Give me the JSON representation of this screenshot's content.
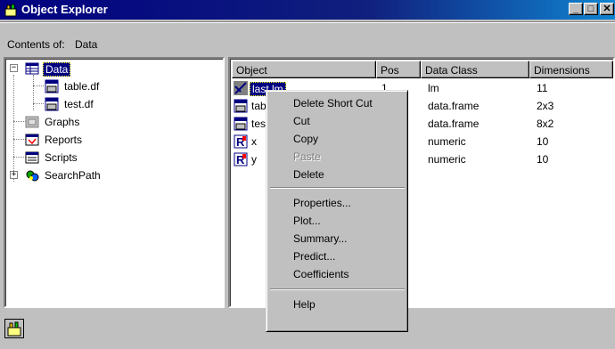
{
  "window": {
    "title": "Object Explorer",
    "icon": "object-explorer-icon",
    "minimize": "_",
    "maximize": "□",
    "close": "✕"
  },
  "contents": {
    "label": "Contents of:",
    "value": "Data"
  },
  "tree": {
    "items": [
      {
        "label": "Data",
        "icon": "data-folder-icon",
        "selected": true,
        "expanded": true
      },
      {
        "label": "table.df",
        "icon": "data-frame-icon"
      },
      {
        "label": "test.df",
        "icon": "data-frame-icon"
      },
      {
        "label": "Graphs",
        "icon": "graphs-icon"
      },
      {
        "label": "Reports",
        "icon": "reports-icon"
      },
      {
        "label": "Scripts",
        "icon": "scripts-icon"
      },
      {
        "label": "SearchPath",
        "icon": "searchpath-icon",
        "expanded": false
      }
    ],
    "expand_minus": "−",
    "expand_plus": "+"
  },
  "list": {
    "columns": [
      "Object",
      "Pos",
      "Data Class",
      "Dimensions"
    ],
    "rows": [
      {
        "object": "last.lm",
        "pos": "1",
        "class": "lm",
        "dims": "11",
        "icon": "model-icon",
        "selected": true
      },
      {
        "object": "tab",
        "pos": "",
        "class": "data.frame",
        "dims": "2x3",
        "icon": "data-frame-icon"
      },
      {
        "object": "tes",
        "pos": "",
        "class": "data.frame",
        "dims": "8x2",
        "icon": "data-frame-icon"
      },
      {
        "object": "x",
        "pos": "",
        "class": "numeric",
        "dims": "10",
        "icon": "vector-icon"
      },
      {
        "object": "y",
        "pos": "",
        "class": "numeric",
        "dims": "10",
        "icon": "vector-icon"
      }
    ]
  },
  "context_menu": {
    "items": [
      {
        "label": "Delete Short Cut",
        "disabled": false
      },
      {
        "label": "Cut",
        "disabled": false
      },
      {
        "label": "Copy",
        "disabled": false
      },
      {
        "label": "Paste",
        "disabled": true
      },
      {
        "label": "Delete",
        "disabled": false
      },
      {
        "label": "Properties...",
        "disabled": false
      },
      {
        "label": "Plot...",
        "disabled": false
      },
      {
        "label": "Summary...",
        "disabled": false
      },
      {
        "label": "Predict...",
        "disabled": false
      },
      {
        "label": "Coefficients",
        "disabled": false
      },
      {
        "label": "Help",
        "disabled": false
      }
    ]
  },
  "status": {
    "icon": "status-explorer-icon"
  },
  "colors": {
    "title_bar": "#000080",
    "selection": "#000080",
    "face": "#c0c0c0"
  }
}
